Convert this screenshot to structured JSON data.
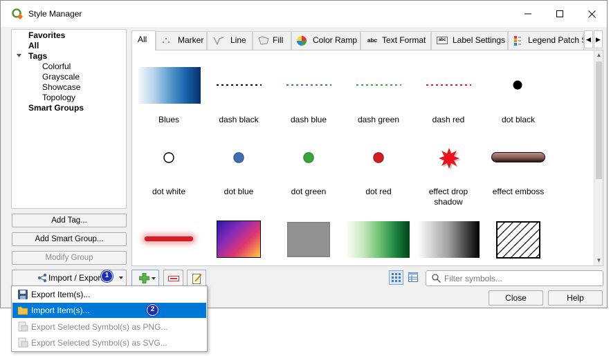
{
  "window": {
    "title": "Style Manager",
    "controls": {
      "minimize": "—",
      "maximize": "☐",
      "close": "✕"
    }
  },
  "tree": {
    "favorites": "Favorites",
    "all": "All",
    "tags": "Tags",
    "tag_items": [
      "Colorful",
      "Grayscale",
      "Showcase",
      "Topology"
    ],
    "smart_groups": "Smart Groups"
  },
  "side_buttons": {
    "add_tag": "Add Tag...",
    "add_smart_group": "Add Smart Group...",
    "modify_group": "Modify Group",
    "import_export": "Import / Export"
  },
  "tabs": [
    {
      "label": "All",
      "icon": ""
    },
    {
      "label": "Marker",
      "icon": "marker-icon"
    },
    {
      "label": "Line",
      "icon": "line-icon"
    },
    {
      "label": "Fill",
      "icon": "fill-icon"
    },
    {
      "label": "Color Ramp",
      "icon": "color-ramp-icon"
    },
    {
      "label": "Text Format",
      "icon": "text-format-icon"
    },
    {
      "label": "Label Settings",
      "icon": "label-settings-icon"
    },
    {
      "label": "Legend Patch Sh",
      "icon": "legend-patch-icon"
    }
  ],
  "symbols": [
    [
      "Blues",
      "dash  black",
      "dash blue",
      "dash green",
      "dash red",
      "dot  black"
    ],
    [
      "dot  white",
      "dot blue",
      "dot green",
      "dot red",
      "effect drop\nshadow",
      "effect emboss"
    ]
  ],
  "search": {
    "placeholder": "Filter symbols..."
  },
  "dialog_buttons": {
    "close": "Close",
    "help": "Help"
  },
  "menu": {
    "items": [
      {
        "label": "Export Item(s)...",
        "icon": "save-icon",
        "state": "normal"
      },
      {
        "label": "Import Item(s)...",
        "icon": "folder-icon",
        "state": "hover"
      },
      {
        "label": "Export Selected Symbol(s) as PNG...",
        "icon": "image-export-icon",
        "state": "disabled"
      },
      {
        "label": "Export Selected Symbol(s) as SVG...",
        "icon": "image-export-icon",
        "state": "disabled"
      }
    ]
  },
  "annotations": {
    "step1": "1",
    "step2": "2"
  },
  "colors": {
    "accent": "#0078d7",
    "badge": "#1c2fb8",
    "blue_symbol": "#3f6fb0",
    "green_symbol": "#3aa63a",
    "red_symbol": "#d21f26"
  }
}
